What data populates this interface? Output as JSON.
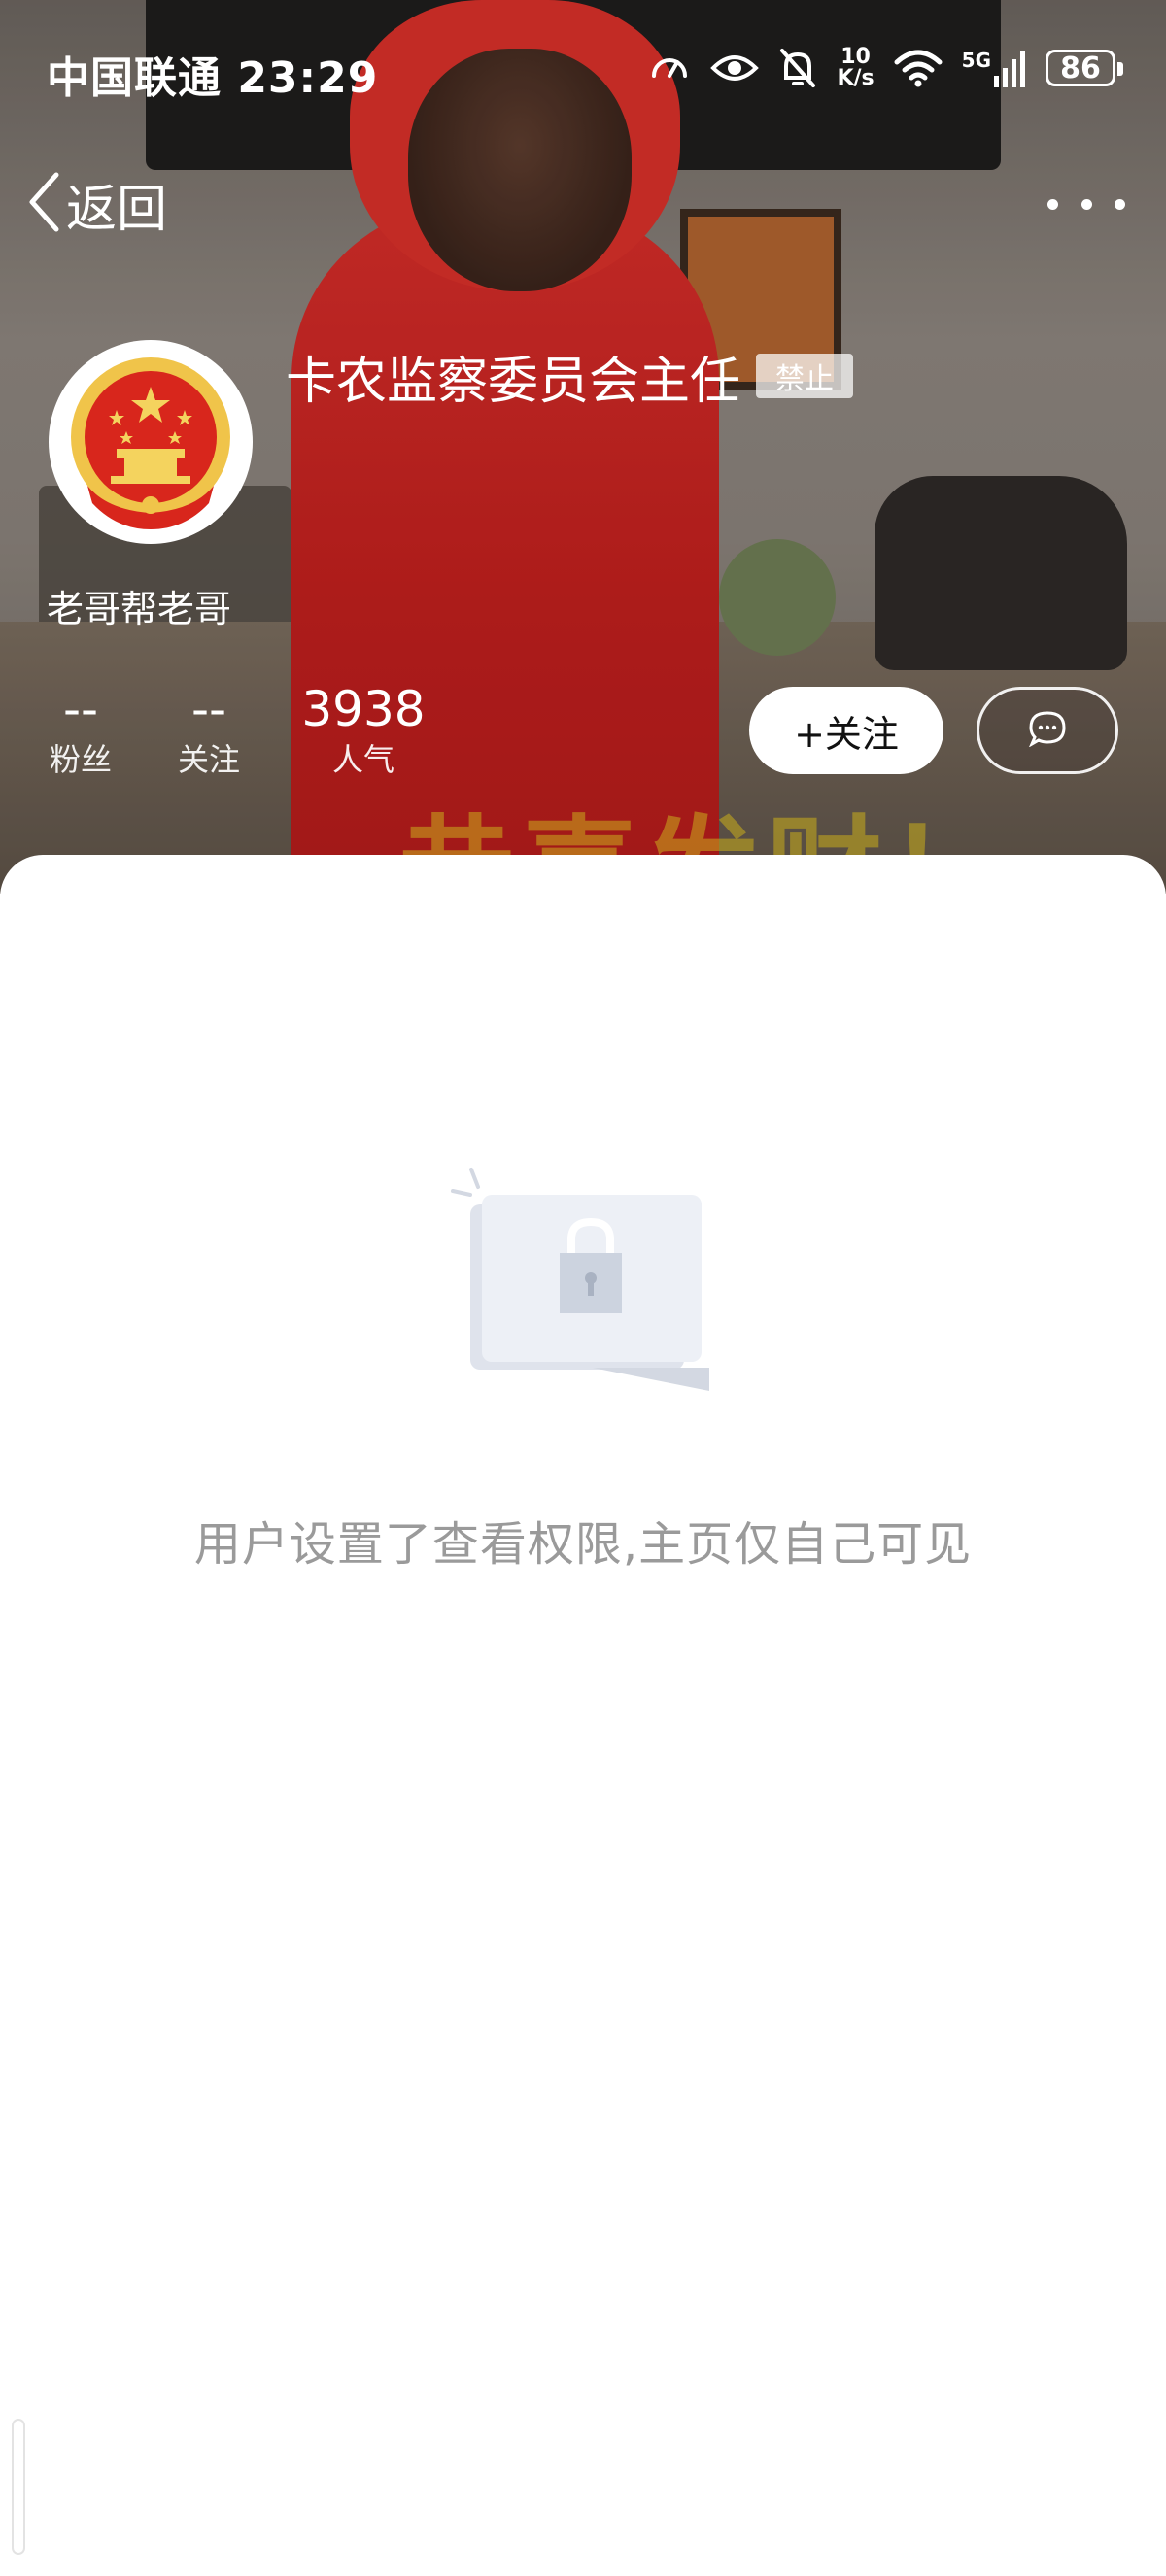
{
  "status_bar": {
    "carrier_time": "中国联通 23:29",
    "net_speed_value": "10",
    "net_speed_unit": "K/s",
    "network_type": "5G",
    "battery": "86"
  },
  "nav": {
    "back_label": "返回"
  },
  "profile": {
    "username": "卡农监察委员会主任",
    "badge": "禁止",
    "group": "老哥帮老哥",
    "stats": {
      "fans_value": "--",
      "fans_label": "粉丝",
      "following_value": "--",
      "following_label": "关注",
      "popularity_value": "3938",
      "popularity_label": "人气"
    },
    "follow_button": "+关注"
  },
  "background_caption": "恭喜发财！",
  "content": {
    "message": "用户设置了查看权限,主页仅自己可见"
  },
  "colors": {
    "sheet": "#ffffff",
    "message_text": "#9a9a9a",
    "emblem_red": "#d8261c",
    "emblem_gold": "#f0c44a"
  }
}
